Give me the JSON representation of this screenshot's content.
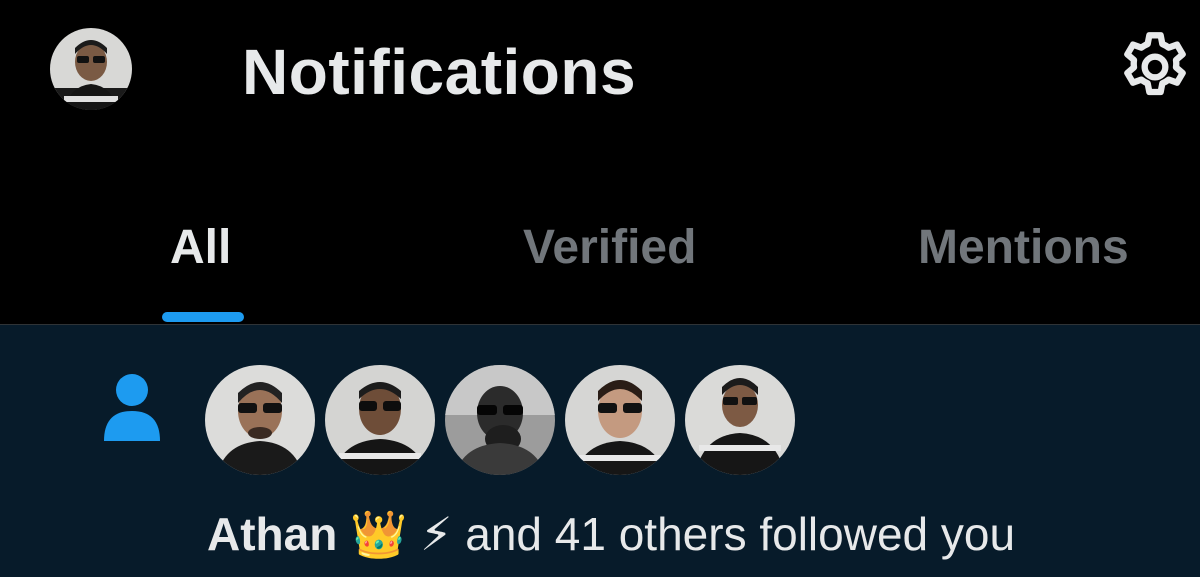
{
  "header": {
    "title": "Notifications",
    "profile_avatar_icon": "profile-avatar",
    "settings_icon": "gear-icon"
  },
  "tabs": [
    {
      "label": "All",
      "active": true
    },
    {
      "label": "Verified",
      "active": false
    },
    {
      "label": "Mentions",
      "active": false
    }
  ],
  "notification": {
    "type_icon": "person-icon",
    "avatars_count": 5,
    "actor_name": "Athan",
    "actor_emojis": "👑 ⚡",
    "message": "and 41 others followed you"
  },
  "colors": {
    "background": "#000000",
    "accent": "#1d9bf0",
    "text_primary": "#e7e9ea",
    "text_secondary": "#71767b",
    "highlight_row": "#071b2a"
  }
}
